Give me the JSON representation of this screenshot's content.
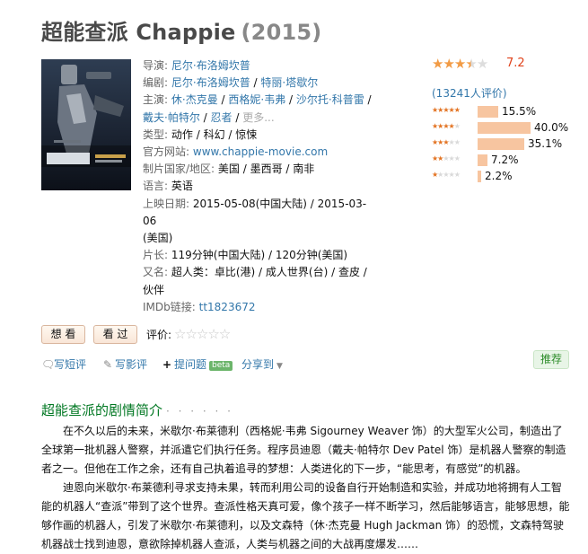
{
  "title": {
    "cn": "超能查派 Chappie",
    "year": "(2015)"
  },
  "info": {
    "director_label": "导演",
    "director": "尼尔·布洛姆坎普",
    "writer_label": "编剧",
    "writers": [
      "尼尔·布洛姆坎普",
      "特丽·塔歇尔"
    ],
    "cast_label": "主演",
    "cast": [
      "休·杰克曼",
      "西格妮·韦弗",
      "沙尔托·科普雷",
      "戴夫·帕特尔",
      "忍者"
    ],
    "more": "更多...",
    "genre_label": "类型:",
    "genres": [
      "动作",
      "科幻",
      "惊悚"
    ],
    "site_label": "官方网站:",
    "site": "www.chappie-movie.com",
    "country_label": "制片国家/地区:",
    "country": "美国 / 墨西哥 / 南非",
    "lang_label": "语言:",
    "lang": "英语",
    "release_label": "上映日期:",
    "release_1": "2015-05-08(中国大陆)",
    "release_2": "2015-03-06",
    "release_3": "(美国)",
    "runtime_label": "片长:",
    "runtime": "119分钟(中国大陆) / 120分钟(美国)",
    "aka_label": "又名:",
    "aka_line1": "超人类：卓比(港) / 成人世界(台) / 查皮 /",
    "aka_line2": "伙伴",
    "imdb_label": "IMDb链接:",
    "imdb": "tt1823672"
  },
  "rating": {
    "score": "7.2",
    "stars_filled": 3.5,
    "votes": "(13241人评价)",
    "dist": [
      {
        "stars": 5,
        "pct": "15.5%",
        "value": 15.5
      },
      {
        "stars": 4,
        "pct": "40.0%",
        "value": 40.0
      },
      {
        "stars": 3,
        "pct": "35.1%",
        "value": 35.1
      },
      {
        "stars": 2,
        "pct": "7.2%",
        "value": 7.2
      },
      {
        "stars": 1,
        "pct": "2.2%",
        "value": 2.2
      }
    ]
  },
  "buttons": {
    "want": "想 看",
    "seen": "看 过",
    "rate_label": "评价:",
    "rate_stars": "☆☆☆☆☆"
  },
  "actions": {
    "review": "写短评",
    "long_review": "写影评",
    "question": "提问题",
    "beta": "beta",
    "share": "分享到",
    "recommend": "推荐"
  },
  "summary": {
    "heading": "超能查派的剧情简介",
    "dots": "· · · · · ·",
    "para1": "在不久以后的未来，米歇尔·布莱德利（西格妮·韦弗 Sigourney Weaver 饰）的大型军火公司，制造出了全球第一批机器人警察，并派遣它们执行任务。程序员迪恩（戴夫·帕特尔 Dev Patel 饰）是机器人警察的制造者之一。但他在工作之余，还有自己执着追寻的梦想：人类进化的下一步，“能思考，有感觉”的机器。",
    "para2": "迪恩向米歇尔·布莱德利寻求支持未果，转而利用公司的设备自行开始制造和实验，并成功地将拥有人工智能的机器人“查派”带到了这个世界。查派性格天真可爱，像个孩子一样不断学习，然后能够语言，能够思想，能够作画的机器人，引发了米歇尔·布莱德利，以及文森特（休·杰克曼 Hugh Jackman 饰）的恐慌，文森特驾驶机器战士找到迪恩，意欲除掉机器人查派，人类与机器之间的大战再度爆发……"
  },
  "colors": {
    "accent_link": "#3377aa",
    "section_green": "#007722",
    "score_red": "#e0421b",
    "star_orange": "#f29b45",
    "bar": "#f7c5a0"
  },
  "icons": [
    "comment-icon",
    "pencil-icon",
    "plus-icon",
    "share-dropdown-icon"
  ]
}
